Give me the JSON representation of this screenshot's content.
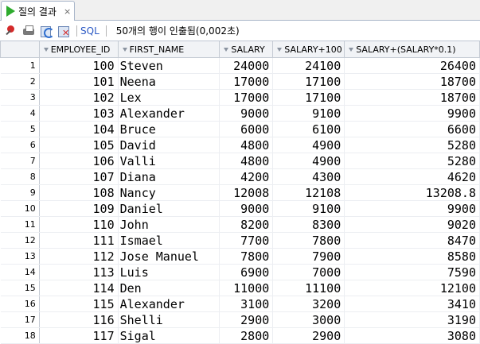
{
  "tab": {
    "title": "질의 결과",
    "close": "×"
  },
  "toolbar": {
    "sql_label": "SQL",
    "status": "50개의 행이 인출됨(0,002초)"
  },
  "table": {
    "columns": [
      "EMPLOYEE_ID",
      "FIRST_NAME",
      "SALARY",
      "SALARY+100",
      "SALARY+(SALARY*0.1)"
    ],
    "rows": [
      [
        "1",
        "100",
        "Steven",
        "24000",
        "24100",
        "26400"
      ],
      [
        "2",
        "101",
        "Neena",
        "17000",
        "17100",
        "18700"
      ],
      [
        "3",
        "102",
        "Lex",
        "17000",
        "17100",
        "18700"
      ],
      [
        "4",
        "103",
        "Alexander",
        "9000",
        "9100",
        "9900"
      ],
      [
        "5",
        "104",
        "Bruce",
        "6000",
        "6100",
        "6600"
      ],
      [
        "6",
        "105",
        "David",
        "4800",
        "4900",
        "5280"
      ],
      [
        "7",
        "106",
        "Valli",
        "4800",
        "4900",
        "5280"
      ],
      [
        "8",
        "107",
        "Diana",
        "4200",
        "4300",
        "4620"
      ],
      [
        "9",
        "108",
        "Nancy",
        "12008",
        "12108",
        "13208.8"
      ],
      [
        "10",
        "109",
        "Daniel",
        "9000",
        "9100",
        "9900"
      ],
      [
        "11",
        "110",
        "John",
        "8200",
        "8300",
        "9020"
      ],
      [
        "12",
        "111",
        "Ismael",
        "7700",
        "7800",
        "8470"
      ],
      [
        "13",
        "112",
        "Jose Manuel",
        "7800",
        "7900",
        "8580"
      ],
      [
        "14",
        "113",
        "Luis",
        "6900",
        "7000",
        "7590"
      ],
      [
        "15",
        "114",
        "Den",
        "11000",
        "11100",
        "12100"
      ],
      [
        "16",
        "115",
        "Alexander",
        "3100",
        "3200",
        "3410"
      ],
      [
        "17",
        "116",
        "Shelli",
        "2900",
        "3000",
        "3190"
      ],
      [
        "18",
        "117",
        "Sigal",
        "2800",
        "2900",
        "3080"
      ]
    ]
  }
}
